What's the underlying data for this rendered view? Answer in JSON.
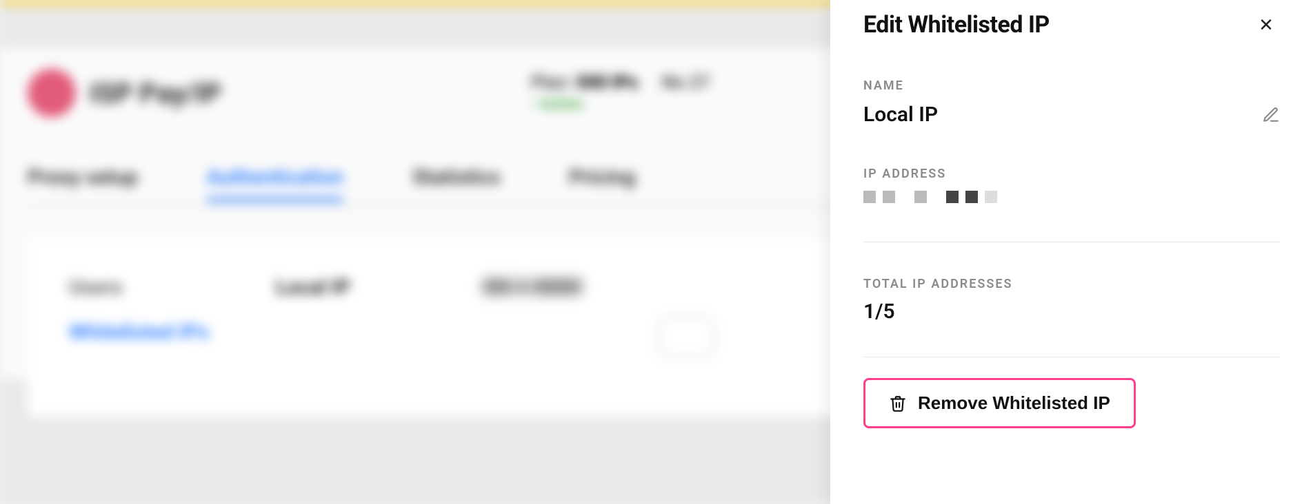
{
  "background": {
    "brand_text": "ISP Pay/IP",
    "plan_prefix": "Plan:",
    "plan_value": "500 IPs",
    "plan_status": "• Active",
    "next_label": "No\n27",
    "tabs": {
      "proxy_setup": "Proxy setup",
      "authentication": "Authentication",
      "statistics": "Statistics",
      "pricing": "Pricing"
    },
    "sidebar": {
      "users": "Users",
      "whitelisted": "Whitelisted IPs"
    },
    "row": {
      "name": "Local IP",
      "ip": "▮▮▮.▮.▮▮▮▮▮"
    }
  },
  "panel": {
    "title": "Edit Whitelisted IP",
    "name_label": "NAME",
    "name_value": "Local IP",
    "ip_label": "IP ADDRESS",
    "total_label": "TOTAL IP ADDRESSES",
    "total_value": "1/5",
    "remove_label": "Remove Whitelisted IP"
  }
}
